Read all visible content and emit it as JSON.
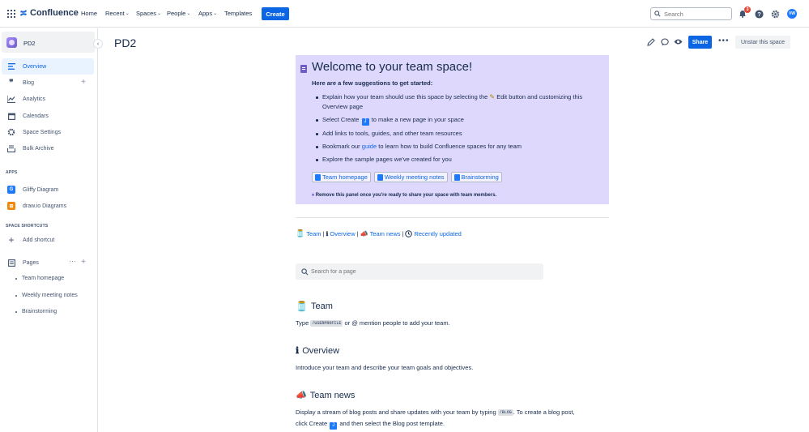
{
  "topbar": {
    "app_name": "Confluence",
    "nav": [
      {
        "label": "Home",
        "dropdown": false
      },
      {
        "label": "Recent",
        "dropdown": true
      },
      {
        "label": "Spaces",
        "dropdown": true
      },
      {
        "label": "People",
        "dropdown": true
      },
      {
        "label": "Apps",
        "dropdown": true
      },
      {
        "label": "Templates",
        "dropdown": false
      }
    ],
    "create_label": "Create",
    "search_placeholder": "Search",
    "notification_count": "3",
    "avatar_initials": "VW"
  },
  "sidebar": {
    "space_name": "PD2",
    "items": [
      {
        "label": "Overview",
        "icon": "overview-icon"
      },
      {
        "label": "Blog",
        "icon": "quote-icon"
      },
      {
        "label": "Analytics",
        "icon": "analytics-icon"
      },
      {
        "label": "Calendars",
        "icon": "calendar-icon"
      },
      {
        "label": "Space Settings",
        "icon": "gear-icon"
      },
      {
        "label": "Bulk Archive",
        "icon": "archive-icon"
      }
    ],
    "apps_heading": "APPS",
    "apps": [
      {
        "label": "Gliffy Diagram",
        "icon": "gliffy-icon"
      },
      {
        "label": "draw.io Diagrams",
        "icon": "drawio-icon"
      }
    ],
    "shortcuts_heading": "SPACE SHORTCUTS",
    "add_shortcut": "Add shortcut",
    "pages_label": "Pages",
    "pages": [
      "Team homepage",
      "Weekly meeting notes",
      "Brainstorming"
    ]
  },
  "header": {
    "title": "PD2",
    "share_label": "Share",
    "unstar_label": "Unstar this space"
  },
  "panel": {
    "title": "Welcome to your team space!",
    "subtitle": "Here are a few suggestions to get started:",
    "bullet1_a": "Explain how your team should use this space by selecting the",
    "bullet1_b": "Edit button and customizing this Overview page",
    "bullet2_a": "Select Create",
    "bullet2_b": "to make a new page in your space",
    "bullet3": "Add links to tools, guides, and other team resources",
    "bullet4_a": "Bookmark our",
    "bullet4_link": "guide",
    "bullet4_b": "to learn how to build Confluence spaces for any team",
    "bullet5": "Explore the sample pages we've created for you",
    "chips": [
      "Team homepage",
      "Weekly meeting notes",
      "Brainstorming"
    ],
    "note": "Remove this panel once you're ready to share your space with team members."
  },
  "quick_links": {
    "team": "Team",
    "overview": "Overview",
    "team_news": "Team news",
    "recently_updated": "Recently updated",
    "separator": "|"
  },
  "page_search_placeholder": "Search for a page",
  "sections": {
    "team_heading": "Team",
    "team_text_a": "Type",
    "team_code": "/USERPROFILE",
    "team_text_b": "or @ mention people to add your team.",
    "overview_heading": "Overview",
    "overview_text": "Introduce your team and describe your team goals and objectives.",
    "news_heading": "Team news",
    "news_text_a": "Display a stream of blog posts and share updates with your team by typing",
    "news_code": "/BLOG",
    "news_text_b": ". To create a blog post,",
    "news_text_c": "click Create",
    "news_text_d": "and then select the Blog post template."
  },
  "colors": {
    "brand": "#0c66e4",
    "panel_bg": "#dfd8fd",
    "active_bg": "#e9f2ff"
  }
}
